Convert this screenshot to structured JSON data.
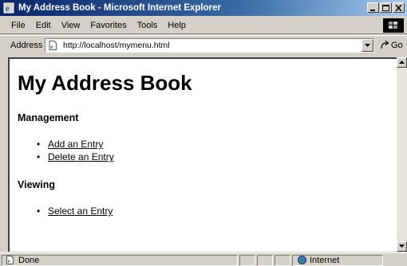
{
  "window": {
    "title": "My Address Book - Microsoft Internet Explorer",
    "controls": [
      "minimize-icon",
      "maximize-icon",
      "close-icon"
    ]
  },
  "menu": {
    "items": [
      {
        "label": "File"
      },
      {
        "label": "Edit"
      },
      {
        "label": "View"
      },
      {
        "label": "Favorites"
      },
      {
        "label": "Tools"
      },
      {
        "label": "Help"
      }
    ]
  },
  "address": {
    "label": "Address",
    "url": "http://localhost/mymenu.html",
    "go_label": "Go"
  },
  "page": {
    "title": "My Address Book",
    "sections": [
      {
        "heading": "Management",
        "links": [
          "Add an Entry",
          "Delete an Entry"
        ]
      },
      {
        "heading": "Viewing",
        "links": [
          "Select an Entry"
        ]
      }
    ]
  },
  "status": {
    "text": "Done",
    "zone": "Internet"
  },
  "colors": {
    "title_bar": "#0a246a",
    "chrome": "#d4d0c8",
    "content_bg": "#ffffff"
  }
}
